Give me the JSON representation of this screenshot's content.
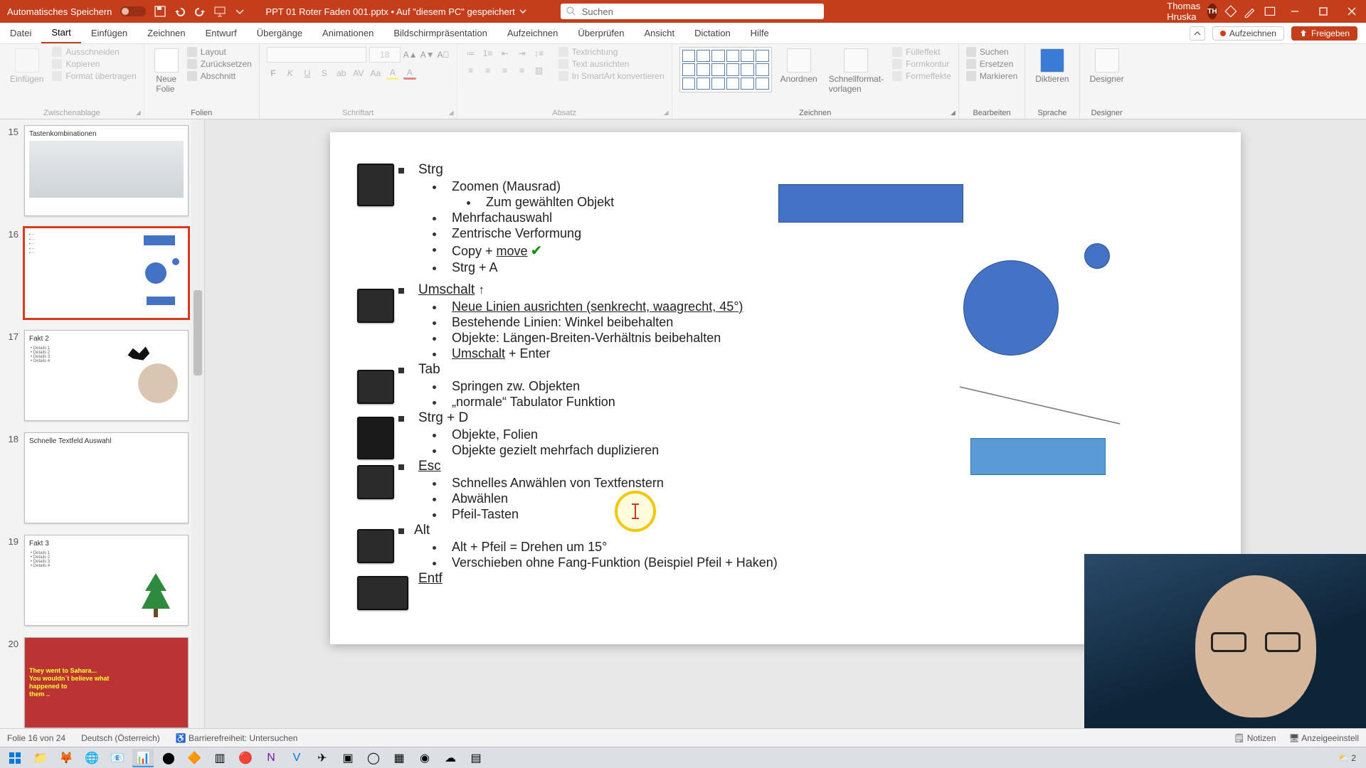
{
  "titlebar": {
    "autosave_label": "Automatisches Speichern",
    "doc_title": "PPT 01 Roter Faden 001.pptx • Auf \"diesem PC\" gespeichert",
    "search_placeholder": "Suchen",
    "user_name": "Thomas Hruska",
    "user_initials": "TH"
  },
  "tabs": {
    "items": [
      "Datei",
      "Start",
      "Einfügen",
      "Zeichnen",
      "Entwurf",
      "Übergänge",
      "Animationen",
      "Bildschirmpräsentation",
      "Aufzeichnen",
      "Überprüfen",
      "Ansicht",
      "Dictation",
      "Hilfe"
    ],
    "active_index": 1,
    "record": "Aufzeichnen",
    "share": "Freigeben"
  },
  "ribbon": {
    "clipboard": {
      "label": "Zwischenablage",
      "paste": "Einfügen",
      "cut": "Ausschneiden",
      "copy": "Kopieren",
      "format": "Format übertragen"
    },
    "slides": {
      "label": "Folien",
      "new": "Neue\nFolie",
      "layout": "Layout",
      "reset": "Zurücksetzen",
      "section": "Abschnitt"
    },
    "font": {
      "label": "Schriftart",
      "size": "18"
    },
    "paragraph": {
      "label": "Absatz",
      "textdir": "Textrichtung",
      "align": "Text ausrichten",
      "smartart": "In SmartArt konvertieren"
    },
    "drawing": {
      "label": "Zeichnen",
      "arrange": "Anordnen",
      "quick": "Schnellformat-\nvorlagen",
      "fill": "Fülleffekt",
      "outline": "Formkontur",
      "effects": "Formeffekte"
    },
    "editing": {
      "label": "Bearbeiten",
      "find": "Suchen",
      "replace": "Ersetzen",
      "select": "Markieren"
    },
    "voice": {
      "label": "Sprache",
      "dictate": "Diktieren"
    },
    "designer": {
      "label": "Designer",
      "btn": "Designer"
    }
  },
  "thumbs": [
    {
      "num": "15",
      "title": "Tastenkombinationen"
    },
    {
      "num": "16",
      "title": ""
    },
    {
      "num": "17",
      "title": "Fakt 2"
    },
    {
      "num": "18",
      "title": "Schnelle Textfeld Auswahl"
    },
    {
      "num": "19",
      "title": "Fakt 3"
    },
    {
      "num": "20",
      "title": ""
    }
  ],
  "slide": {
    "strg": "Strg",
    "strg_items": [
      "Zoomen (Mausrad)",
      "Zum gewählten Objekt",
      "Mehrfachauswahl",
      "Zentrische Verformung",
      "Copy + move",
      "Strg + A"
    ],
    "umschalt": "Umschalt",
    "umschalt_items": [
      "Neue Linien ausrichten (senkrecht, waagrecht, 45°)",
      "Bestehende Linien: Winkel beibehalten",
      "Objekte: Längen-Breiten-Verhältnis beibehalten",
      "Umschalt + Enter"
    ],
    "tab": "Tab",
    "tab_items": [
      "Springen zw. Objekten",
      "„normale“ Tabulator Funktion"
    ],
    "strgd": "Strg + D",
    "strgd_items": [
      "Objekte, Folien",
      "Objekte gezielt mehrfach duplizieren"
    ],
    "esc": "Esc",
    "esc_items": [
      "Schnelles Anwählen von Textfenstern",
      "Abwählen",
      "Pfeil-Tasten"
    ],
    "alt": "Alt",
    "alt_items": [
      "Alt + Pfeil = Drehen um 15°",
      "Verschieben ohne Fang-Funktion (Beispiel Pfeil + Haken)"
    ],
    "entf": "Entf",
    "copy": "Copy + ",
    "move": "move",
    "umschalt_enter_a": "Umschalt",
    "umschalt_enter_b": " + Enter"
  },
  "status": {
    "slide": "Folie 16 von 24",
    "lang": "Deutsch (Österreich)",
    "access": "Barrierefreiheit: Untersuchen",
    "notes": "Notizen",
    "display": "Anzeigeeinstell"
  },
  "taskbar": {
    "temp": "2"
  }
}
